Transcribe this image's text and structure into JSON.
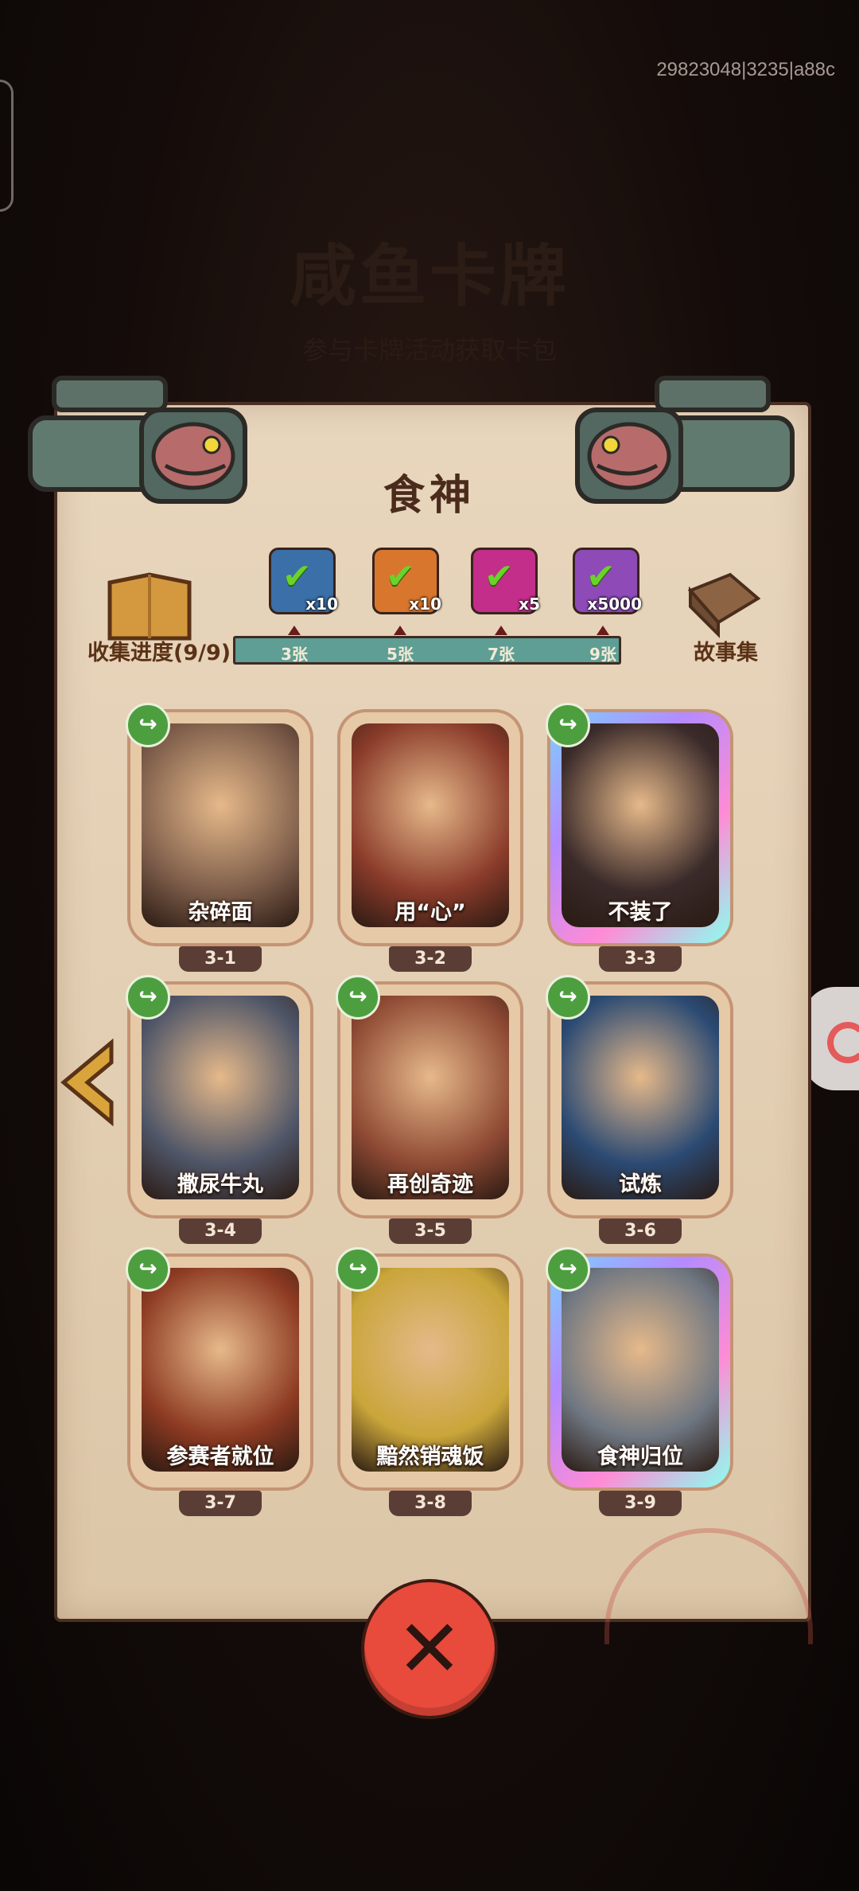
{
  "version_text": "29823048|3235|a88c",
  "background": {
    "title": "咸鱼卡牌",
    "subtitle": "参与卡牌活动获取卡包"
  },
  "panel": {
    "title": "食神",
    "collect_label": "收集进度(9/9)",
    "story_label": "故事集",
    "progress": 1.0,
    "milestones": [
      "3张",
      "5张",
      "7张",
      "9张"
    ],
    "rewards": [
      {
        "count": "x10",
        "color": "#3b6fa8",
        "icon": "chest-icon"
      },
      {
        "count": "x10",
        "color": "#d9762e",
        "icon": "ticket-icon"
      },
      {
        "count": "x5",
        "color": "#c22e8a",
        "icon": "orb-icon"
      },
      {
        "count": "x5000",
        "color": "#8e4bb8",
        "icon": "crystal-icon"
      }
    ]
  },
  "cards": [
    {
      "title": "杂碎面",
      "num": "3-1",
      "shareable": true,
      "holo": false,
      "art": "#7d5d4a"
    },
    {
      "title": "用“心”",
      "num": "3-2",
      "shareable": false,
      "holo": false,
      "art": "#8a3b2a"
    },
    {
      "title": "不装了",
      "num": "3-3",
      "shareable": true,
      "holo": true,
      "art": "#3a2a2a"
    },
    {
      "title": "撒尿牛丸",
      "num": "3-4",
      "shareable": true,
      "holo": false,
      "art": "#4f5668"
    },
    {
      "title": "再创奇迹",
      "num": "3-5",
      "shareable": true,
      "holo": false,
      "art": "#8f4a34"
    },
    {
      "title": "试炼",
      "num": "3-6",
      "shareable": true,
      "holo": false,
      "art": "#2b4a73"
    },
    {
      "title": "参赛者就位",
      "num": "3-7",
      "shareable": true,
      "holo": false,
      "art": "#8d3a22"
    },
    {
      "title": "黯然销魂饭",
      "num": "3-8",
      "shareable": true,
      "holo": false,
      "art": "#c9a53a"
    },
    {
      "title": "食神归位",
      "num": "3-9",
      "shareable": true,
      "holo": true,
      "art": "#6f7782"
    }
  ],
  "icons": {
    "share": "↪",
    "close": "✕"
  }
}
